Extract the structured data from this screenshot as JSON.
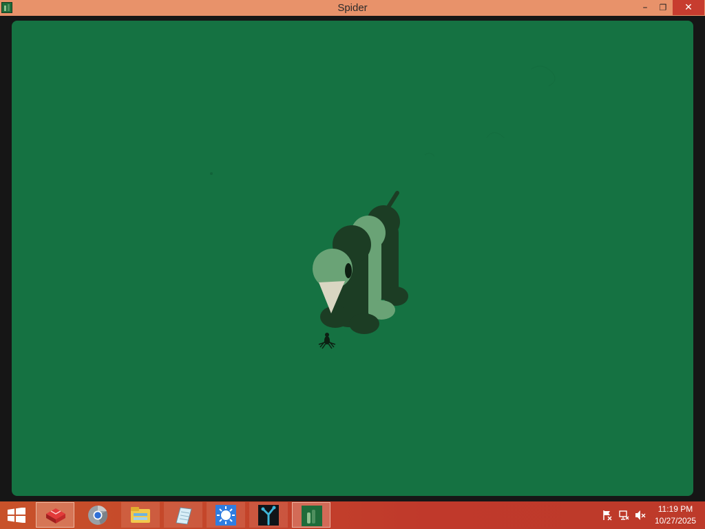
{
  "window": {
    "title": "Spider",
    "minimize_glyph": "–",
    "maximize_glyph": "❐",
    "close_glyph": "✕"
  },
  "colors": {
    "titlebar": "#e8926a",
    "background": "#157242",
    "close_button": "#c73c2f",
    "taskbar": "#c0392b"
  },
  "taskbar": {
    "start_icon": "windows-logo-icon",
    "apps": [
      {
        "name": "toolbox-app",
        "icon": "red-box-icon"
      },
      {
        "name": "chrome-app",
        "icon": "chrome-icon"
      },
      {
        "name": "file-explorer-app",
        "icon": "folder-icon"
      },
      {
        "name": "notes-app",
        "icon": "notepad-icon"
      },
      {
        "name": "weather-app",
        "icon": "sun-icon"
      },
      {
        "name": "network-app",
        "icon": "tree-icon"
      },
      {
        "name": "spider-app",
        "icon": "spider-game-icon"
      }
    ]
  },
  "tray": {
    "time": "11:19 PM",
    "date": "10/27/2025",
    "icons": [
      "action-center-flag-icon",
      "network-icon",
      "volume-muted-icon"
    ]
  }
}
